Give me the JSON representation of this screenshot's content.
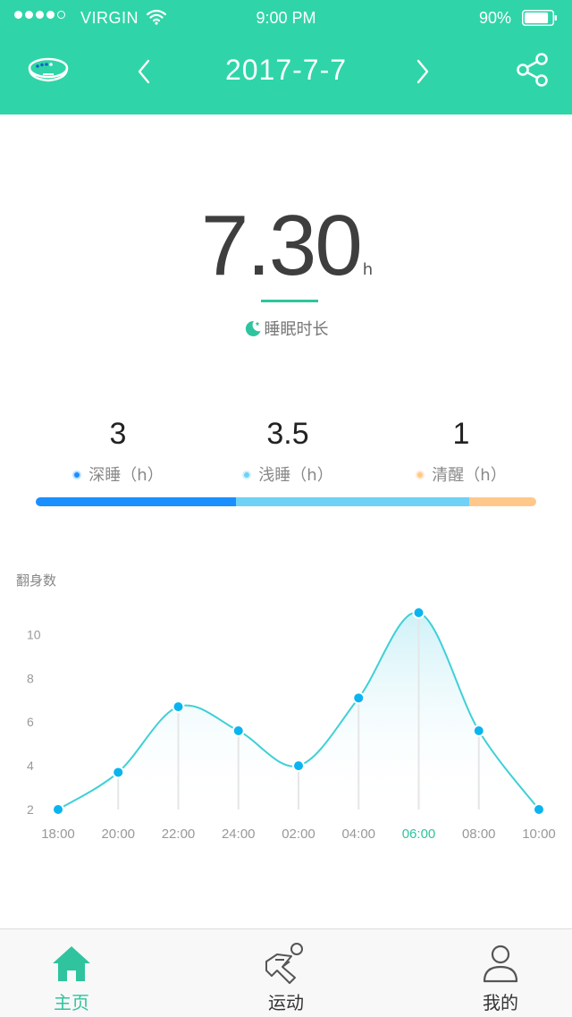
{
  "status_bar": {
    "carrier": "VIRGIN",
    "time": "9:00 PM",
    "battery": "90%",
    "battery_level": 0.9,
    "signal_bars": 4
  },
  "header": {
    "date": "2017-7-7",
    "background": "#2fd5a8"
  },
  "summary": {
    "total": "7.30",
    "unit": "h",
    "label": "睡眠时长"
  },
  "stats": [
    {
      "value": "3",
      "label": "深睡（h）",
      "color": "#1a8fff"
    },
    {
      "value": "3.5",
      "label": "浅睡（h）",
      "color": "#6fd1f5"
    },
    {
      "value": "1",
      "label": "清醒（h）",
      "color": "#ffc88a"
    }
  ],
  "chart_data": {
    "type": "line",
    "ylabel": "翻身数",
    "x": [
      "18:00",
      "20:00",
      "22:00",
      "24:00",
      "02:00",
      "04:00",
      "06:00",
      "08:00",
      "10:00"
    ],
    "y_ticks": [
      2,
      4,
      6,
      8,
      10
    ],
    "ylim": [
      2,
      11
    ],
    "values": [
      2,
      3.7,
      6.7,
      5.6,
      4.0,
      7.1,
      11.0,
      5.6,
      2.0
    ],
    "highlight_tick": "06:00",
    "line_color": "#3fd0d6",
    "point_color": "#0ab4f0",
    "grid": false
  },
  "tabbar": {
    "items": [
      {
        "label": "主页",
        "icon": "home-icon",
        "active": true
      },
      {
        "label": "运动",
        "icon": "running-icon",
        "active": false
      },
      {
        "label": "我的",
        "icon": "person-icon",
        "active": false
      }
    ],
    "active_color": "#2fc49d"
  }
}
